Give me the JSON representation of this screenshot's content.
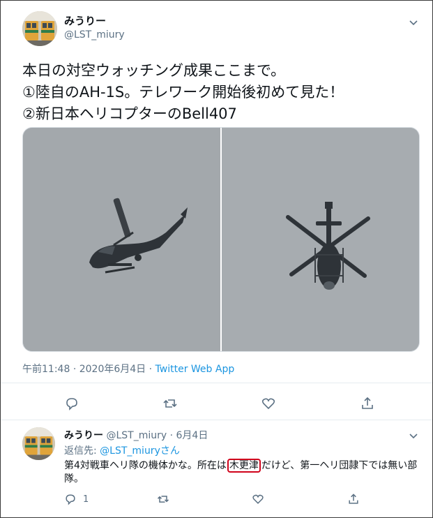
{
  "tweet": {
    "display_name": "みうりー",
    "handle": "@LST_miury",
    "text_lines": [
      "本日の対空ウォッチング成果ここまで。",
      "①陸自のAH-1S。テレワーク開始後初めて見た！",
      "②新日本ヘリコプターのBell407"
    ],
    "media": [
      {
        "subject": "AH-1S helicopter"
      },
      {
        "subject": "Bell407 helicopter"
      }
    ],
    "time": "午前11:48",
    "date": "2020年6月4日",
    "separator": "·",
    "source_app": "Twitter Web App",
    "actions": [
      "reply-icon",
      "retweet-icon",
      "like-icon",
      "share-icon"
    ]
  },
  "reply": {
    "display_name": "みうりー",
    "handle": "@LST_miury",
    "separator": "·",
    "date": "6月4日",
    "replying_to_label": "返信先:",
    "replying_to_handle": "@LST_miury",
    "replying_to_suffix": "さん",
    "text_before": "第4対戦車ヘリ隊の機体かな。所在は",
    "text_highlight": "木更津",
    "text_after": "だけど、第一ヘリ団隷下では無い部隊。",
    "reply_count": "1",
    "highlight_color": "#d0021b"
  },
  "colors": {
    "link": "#1b95e0",
    "secondary_text": "#5b7083",
    "divider": "#e6ecf0"
  }
}
